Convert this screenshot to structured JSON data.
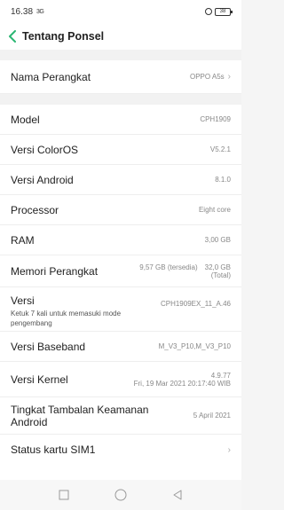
{
  "status_bar": {
    "time": "16.38",
    "sim": "3G",
    "battery": "38"
  },
  "header": {
    "title": "Tentang Ponsel"
  },
  "device_name": {
    "label": "Nama Perangkat",
    "value": "OPPO A5s"
  },
  "items": [
    {
      "label": "Model",
      "value": "CPH1909"
    },
    {
      "label": "Versi ColorOS",
      "value": "V5.2.1"
    },
    {
      "label": "Versi Android",
      "value": "8.1.0"
    },
    {
      "label": "Processor",
      "value": "Eight core"
    },
    {
      "label": "RAM",
      "value": "3,00 GB"
    }
  ],
  "storage": {
    "label": "Memori Perangkat",
    "available": "9,57 GB (tersedia)",
    "total": "32,0 GB",
    "total_note": "(Total)"
  },
  "version": {
    "label": "Versi",
    "hint": "Ketuk 7 kali untuk memasuki mode pengembang",
    "value": "CPH1909EX_11_A.46"
  },
  "baseband": {
    "label": "Versi Baseband",
    "value": "M_V3_P10,M_V3_P10"
  },
  "kernel": {
    "label": "Versi Kernel",
    "version": "4.9.77",
    "date": "Fri, 19 Mar 2021 20:17:40 WIB"
  },
  "security_patch": {
    "label": "Tingkat Tambalan Keamanan Android",
    "value": "5 April 2021"
  },
  "sim_status": {
    "label": "Status kartu SIM1"
  }
}
